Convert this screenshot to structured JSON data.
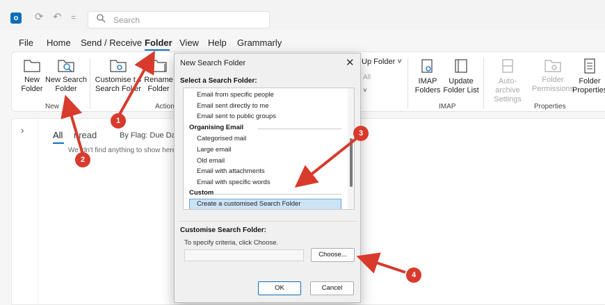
{
  "titlebar": {
    "logo_letter": "o",
    "refresh_glyph": "⟳",
    "undo_glyph": "↶",
    "more_glyph": "=",
    "search_placeholder": "Search"
  },
  "menu": [
    "File",
    "Home",
    "Send / Receive",
    "Folder",
    "View",
    "Help",
    "Grammarly"
  ],
  "active_menu": "Folder",
  "ribbon": {
    "new_folder": [
      "New",
      "Folder"
    ],
    "new_search_folder": [
      "New Search",
      "Folder"
    ],
    "group_new": "New",
    "customise": [
      "Customise t  s",
      "Search Fol  er"
    ],
    "rename": [
      "Rename",
      "Folder"
    ],
    "group_actions": "Actions",
    "cleanup_label": "Up Folder ˅",
    "cleanup_all": "All",
    "cleanup_chevron": "˅",
    "imap_folders": [
      "IMAP",
      "Folders"
    ],
    "update_folder_list": [
      "Update",
      "Folder List"
    ],
    "group_imap": "IMAP",
    "auto_archive": [
      "Auto-archive",
      "Settings"
    ],
    "folder_permissions": [
      "Folder",
      "Permissions"
    ],
    "folder_properties": [
      "Folder",
      "Properties"
    ],
    "group_properties": "Properties"
  },
  "maillist": {
    "expand_glyph": "›",
    "tab_all": "All",
    "tab_unread": "nread",
    "tab_flag": "By Flag: Due Date",
    "empty_message": "We  idn't find anything to show here."
  },
  "dialog": {
    "title": "New Search Folder",
    "close_glyph": "✕",
    "select_label": "Select a Search Folder:",
    "list_items": [
      {
        "text": "Email from specific people",
        "kind": "item"
      },
      {
        "text": "Email sent directly to me",
        "kind": "item"
      },
      {
        "text": "Email sent to public groups",
        "kind": "item"
      },
      {
        "text": "Organising Email",
        "kind": "category"
      },
      {
        "text": "Categorised mail",
        "kind": "item"
      },
      {
        "text": "Large email",
        "kind": "item"
      },
      {
        "text": "Old email",
        "kind": "item"
      },
      {
        "text": "Email with attachments",
        "kind": "item"
      },
      {
        "text": "Email with specific words",
        "kind": "item"
      },
      {
        "text": "Custom",
        "kind": "category"
      },
      {
        "text": "Create a customised Search Folder",
        "kind": "selected"
      }
    ],
    "customise_label": "Customise Search Folder:",
    "criteria_label": "To specify criteria, click Choose.",
    "criteria_value": "",
    "choose_button": "Choose...",
    "ok_button": "OK",
    "cancel_button": "Cancel"
  },
  "annotations": {
    "badge_1": "1",
    "badge_2": "2",
    "badge_3": "3",
    "badge_4": "4",
    "color": "#d83a2b"
  }
}
